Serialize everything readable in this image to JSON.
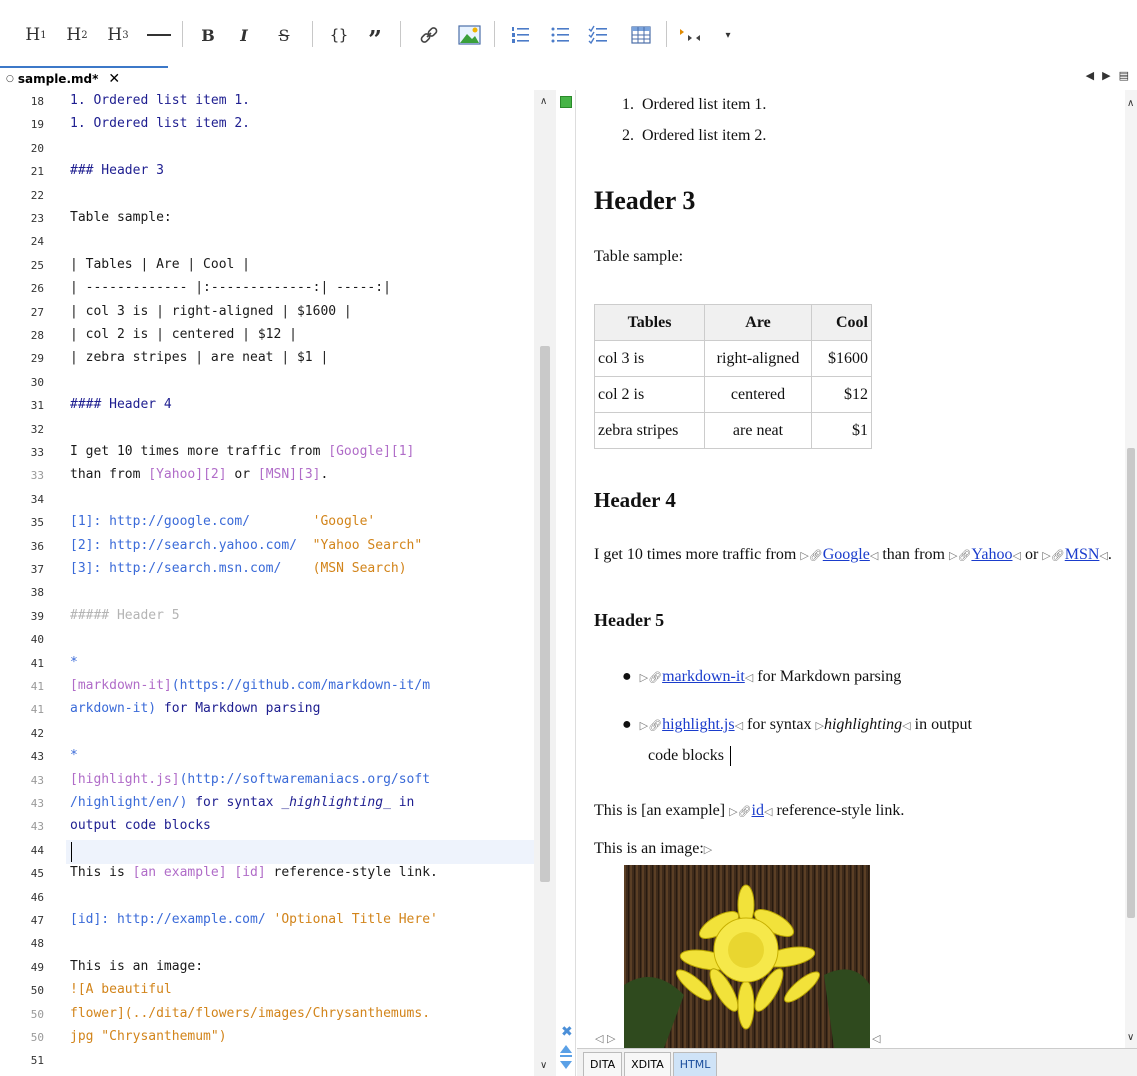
{
  "toolbar": {
    "h1": "H",
    "h1_sub": "1",
    "h2": "H",
    "h2_sub": "2",
    "h3": "H",
    "h3_sub": "3",
    "bold": "B",
    "italic": "I",
    "strike": "S",
    "code": "{}",
    "quote": "”"
  },
  "tab": {
    "title": "sample.md*",
    "close": "✕"
  },
  "editor": {
    "lines": [
      {
        "n": "18",
        "text": "1. Ordered list item 1."
      },
      {
        "n": "19",
        "text": "1. Ordered list item 2."
      },
      {
        "n": "20",
        "text": ""
      },
      {
        "n": "21",
        "text": "### Header 3"
      },
      {
        "n": "22",
        "text": ""
      },
      {
        "n": "23",
        "text": "Table sample:"
      },
      {
        "n": "24",
        "text": ""
      },
      {
        "n": "25",
        "text": "| Tables | Are | Cool |"
      },
      {
        "n": "26",
        "text": "| ------------- |:-------------:| -----:|"
      },
      {
        "n": "27",
        "text": "| col 3 is | right-aligned | $1600 |"
      },
      {
        "n": "28",
        "text": "| col 2 is | centered | $12 |"
      },
      {
        "n": "29",
        "text": "| zebra stripes | are neat | $1 |"
      },
      {
        "n": "30",
        "text": ""
      },
      {
        "n": "31",
        "text": "#### Header 4"
      },
      {
        "n": "32",
        "text": ""
      },
      {
        "n": "33",
        "text": "I get 10 times more traffic from "
      },
      {
        "n": "33",
        "text": "than from "
      },
      {
        "n": "34",
        "text": ""
      },
      {
        "n": "35",
        "text": ""
      },
      {
        "n": "36",
        "text": ""
      },
      {
        "n": "37",
        "text": ""
      },
      {
        "n": "38",
        "text": ""
      },
      {
        "n": "39",
        "text": "##### Header 5"
      },
      {
        "n": "40",
        "text": ""
      },
      {
        "n": "41",
        "text": "*"
      },
      {
        "n": "41",
        "text": ""
      },
      {
        "n": "41",
        "text": ""
      },
      {
        "n": "42",
        "text": ""
      },
      {
        "n": "43",
        "text": "*"
      },
      {
        "n": "43",
        "text": ""
      },
      {
        "n": "43",
        "text": ""
      },
      {
        "n": "43",
        "text": "output code blocks"
      },
      {
        "n": "44",
        "text": ""
      },
      {
        "n": "45",
        "text": "This is "
      },
      {
        "n": "46",
        "text": ""
      },
      {
        "n": "47",
        "text": ""
      },
      {
        "n": "48",
        "text": ""
      },
      {
        "n": "49",
        "text": "This is an image:"
      },
      {
        "n": "50",
        "text": ""
      },
      {
        "n": "50",
        "text": ""
      },
      {
        "n": "50",
        "text": ""
      },
      {
        "n": "51",
        "text": ""
      }
    ],
    "frag": {
      "google_ref": "[Google][1]",
      "yahoo_ref": "[Yahoo][2]",
      "or": " or ",
      "msn_ref": "[MSN][3]",
      "period": ".",
      "ref1": "[1]: http://google.com/",
      "ref1_title": "'Google'",
      "ref2": "[2]: http://search.yahoo.com/",
      "ref2_title": "\"Yahoo Search\"",
      "ref3": "[3]: http://search.msn.com/",
      "ref3_title": "(MSN Search)",
      "mdit_link": "[markdown-it]",
      "mdit_url1": "(https://github.com/markdown-it/m",
      "mdit_url2": "arkdown-it)",
      "mdit_rest": " for Markdown parsing",
      "hl_link": "[highlight.js]",
      "hl_url1": "(http://softwaremaniacs.org/soft",
      "hl_url2": "/highlight/en/)",
      "hl_rest1": " for syntax ",
      "hl_em": "_highlighting_",
      "hl_rest2": " in",
      "ex_text": "[an example]",
      "ex_id": "[id]",
      "ex_rest": " reference-style link.",
      "id_def": "[id]: http://example.com/",
      "id_title": "'Optional Title Here'",
      "img1": "![A beautiful",
      "img2a": "flower]",
      "img2b": "(../dita/flowers/images/Chrysanthemums.",
      "img3a": "jpg",
      "img3b": " \"Chrysanthemum\")"
    }
  },
  "preview": {
    "ol": [
      "Ordered list item 1.",
      "Ordered list item 2."
    ],
    "h3": "Header 3",
    "table_intro": "Table sample:",
    "table": {
      "headers": [
        "Tables",
        "Are",
        "Cool"
      ],
      "rows": [
        [
          "col 3 is",
          "right-aligned",
          "$1600"
        ],
        [
          "col 2 is",
          "centered",
          "$12"
        ],
        [
          "zebra stripes",
          "are neat",
          "$1"
        ]
      ]
    },
    "h4": "Header 4",
    "p1_a": "I get 10 times more traffic from ",
    "p1_google": "Google",
    "p1_b": " than from ",
    "p1_yahoo": "Yahoo",
    "p1_c": " or ",
    "p1_msn": "MSN",
    "p1_d": ".",
    "h5": "Header 5",
    "li1_link": "markdown-it",
    "li1_rest": " for Markdown parsing",
    "li2_link": "highlight.js",
    "li2_a": " for syntax ",
    "li2_em": "highlighting",
    "li2_b": " in output",
    "li2_c": "code blocks",
    "p2_a": "This is [an example] ",
    "p2_id": "id",
    "p2_b": " reference-style link.",
    "p3": "This is an image:"
  },
  "bottom_tabs": [
    "DITA",
    "XDITA",
    "HTML"
  ],
  "colors": {
    "accent": "#3c78c8",
    "link": "#1a3ccc",
    "markdown_link": "#b06cc8",
    "markdown_url": "#3a6ad8",
    "markdown_string": "#d2841a"
  }
}
